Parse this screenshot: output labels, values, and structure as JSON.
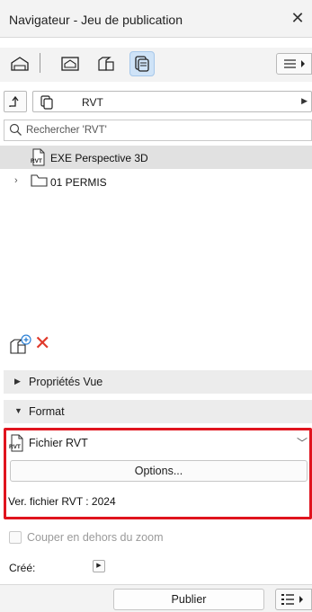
{
  "window": {
    "title": "Navigateur - Jeu de publication",
    "close_glyph": "✕"
  },
  "toolbar": {
    "icons": [
      "project-map-icon",
      "view-map-icon",
      "layout-book-icon",
      "publisher-sets-icon"
    ],
    "active_icon": "publisher-sets-icon",
    "menu_icon": "hamburger-menu-icon"
  },
  "path": {
    "label": "RVT"
  },
  "search": {
    "placeholder": "Rechercher 'RVT'"
  },
  "tree": {
    "items": [
      {
        "label": "EXE Perspective 3D",
        "icon": "rvt-file-icon",
        "selected": true
      },
      {
        "label": "01 PERMIS",
        "icon": "folder-icon",
        "expandable": true
      }
    ]
  },
  "panels": {
    "proprietes": {
      "label": "Propriétés Vue",
      "expanded": false
    },
    "format": {
      "label": "Format",
      "expanded": true
    }
  },
  "format": {
    "file_type": "Fichier RVT",
    "options_label": "Options...",
    "version_label": "Ver. fichier RVT : 2024"
  },
  "crop": {
    "label": "Couper en dehors du zoom",
    "checked": false,
    "enabled": false
  },
  "cree": {
    "label": "Créé:"
  },
  "footer": {
    "publish_label": "Publier"
  },
  "colors": {
    "highlight_box": "#e0141e",
    "delete": "#e0392b",
    "active_tab": "#cfe3f7",
    "add": "#2a7fd4"
  }
}
